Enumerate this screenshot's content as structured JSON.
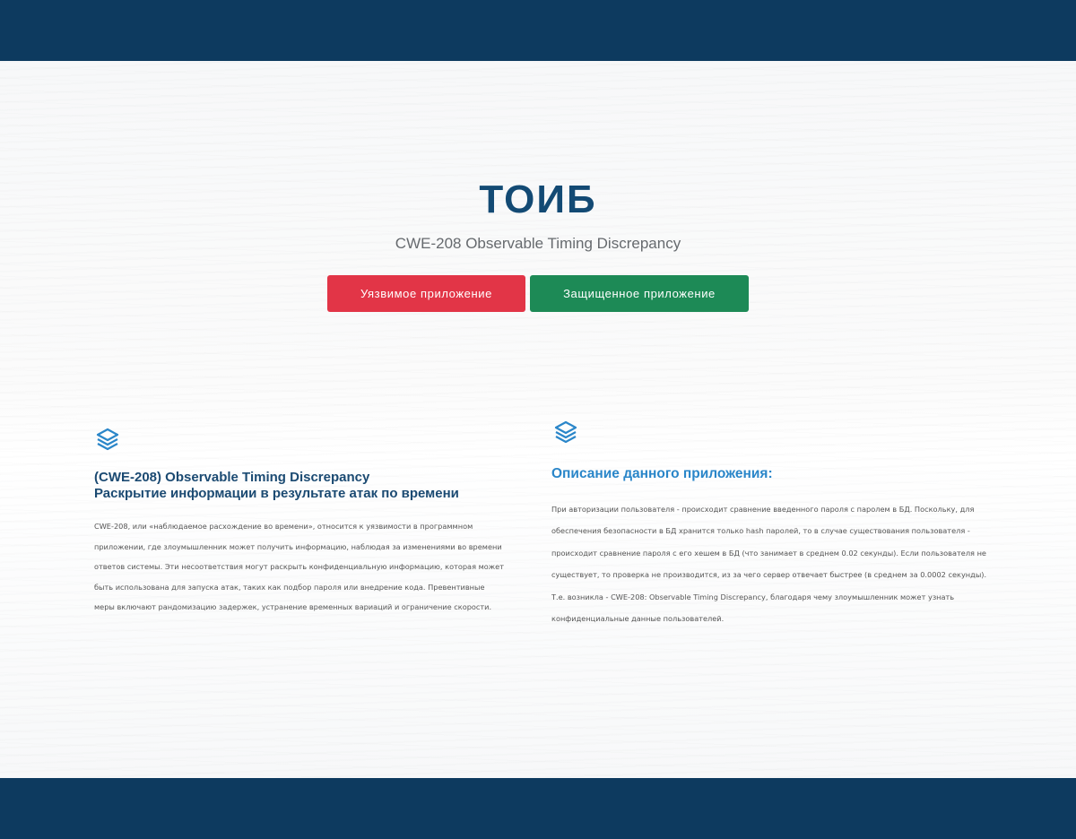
{
  "header": {
    "color": "#0d3a5f"
  },
  "hero": {
    "title": "ТОИБ",
    "subtitle": "CWE-208 Observable Timing Discrepancy",
    "buttons": {
      "vulnerable": "Уязвимое приложение",
      "secure": "Защищенное приложение"
    },
    "colors": {
      "vulnerable": "#e23547",
      "secure": "#1d8a56",
      "title": "#134a74"
    }
  },
  "left_column": {
    "icon": "layers-icon",
    "title_line1": "(CWE-208) Observable Timing Discrepancy",
    "title_line2": "Раскрытие информации в результате атак по времени",
    "text": "CWE-208, или «наблюдаемое расхождение во времени», относится к уязвимости в программном приложении, где злоумышленник может получить информацию, наблюдая за изменениями во времени ответов системы. Эти несоответствия могут раскрыть конфиденциальную информацию, которая может быть использована для запуска атак, таких как подбор пароля или внедрение кода. Превентивные меры включают рандомизацию задержек, устранение временных вариаций и ограничение скорости."
  },
  "right_column": {
    "icon": "layers-icon",
    "title": "Описание данного приложения:",
    "text": "При авторизации пользователя - происходит сравнение введенного пароля с паролем в БД. Поскольку, для обеспечения безопасности в БД хранится только hash паролей, то в случае существования пользователя - происходит сравнение пароля с его хешем в БД (что занимает в среднем 0.02 секунды). Если пользователя не существует, то проверка не производится, из за чего сервер отвечает быстрее (в среднем за 0.0002 секунды). Т.е. возникла - CWE-208: Observable Timing Discrepancy, благодаря чему злоумышленник может узнать конфиденциальные данные пользователей."
  }
}
